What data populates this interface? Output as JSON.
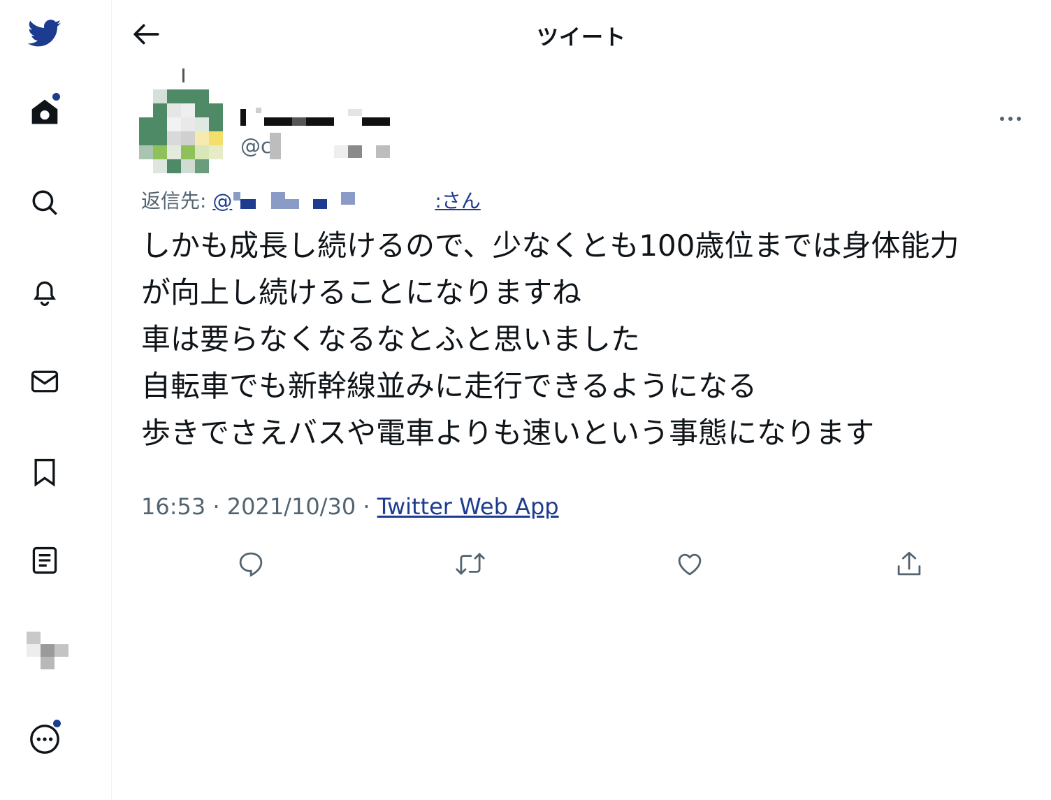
{
  "header": {
    "title": "ツイート"
  },
  "sidebar": {
    "items": [
      {
        "name": "twitter-logo-icon"
      },
      {
        "name": "home-icon"
      },
      {
        "name": "explore-icon"
      },
      {
        "name": "notifications-icon"
      },
      {
        "name": "messages-icon"
      },
      {
        "name": "bookmarks-icon"
      },
      {
        "name": "lists-icon"
      },
      {
        "name": "profile-avatar"
      },
      {
        "name": "more-icon"
      }
    ]
  },
  "tweet": {
    "handle_prefix": "@c",
    "reply_prefix": "返信先: ",
    "reply_handle_prefix": "@",
    "reply_handle_suffix": ":さん",
    "text": "しかも成長し続けるので、少なくとも100歳位までは身体能力\nが向上し続けることになりますね\n車は要らなくなるなとふと思いました\n自転車でも新幹線並みに走行できるようになる\n歩きでさえバスや電車よりも速いという事態になります",
    "time": "16:53",
    "separator": " · ",
    "date": "2021/10/30",
    "source": "Twitter Web App"
  },
  "colors": {
    "accent": "#1d3b8f",
    "brand": "#1d9bf0",
    "muted": "#536471",
    "text": "#0f1419"
  }
}
